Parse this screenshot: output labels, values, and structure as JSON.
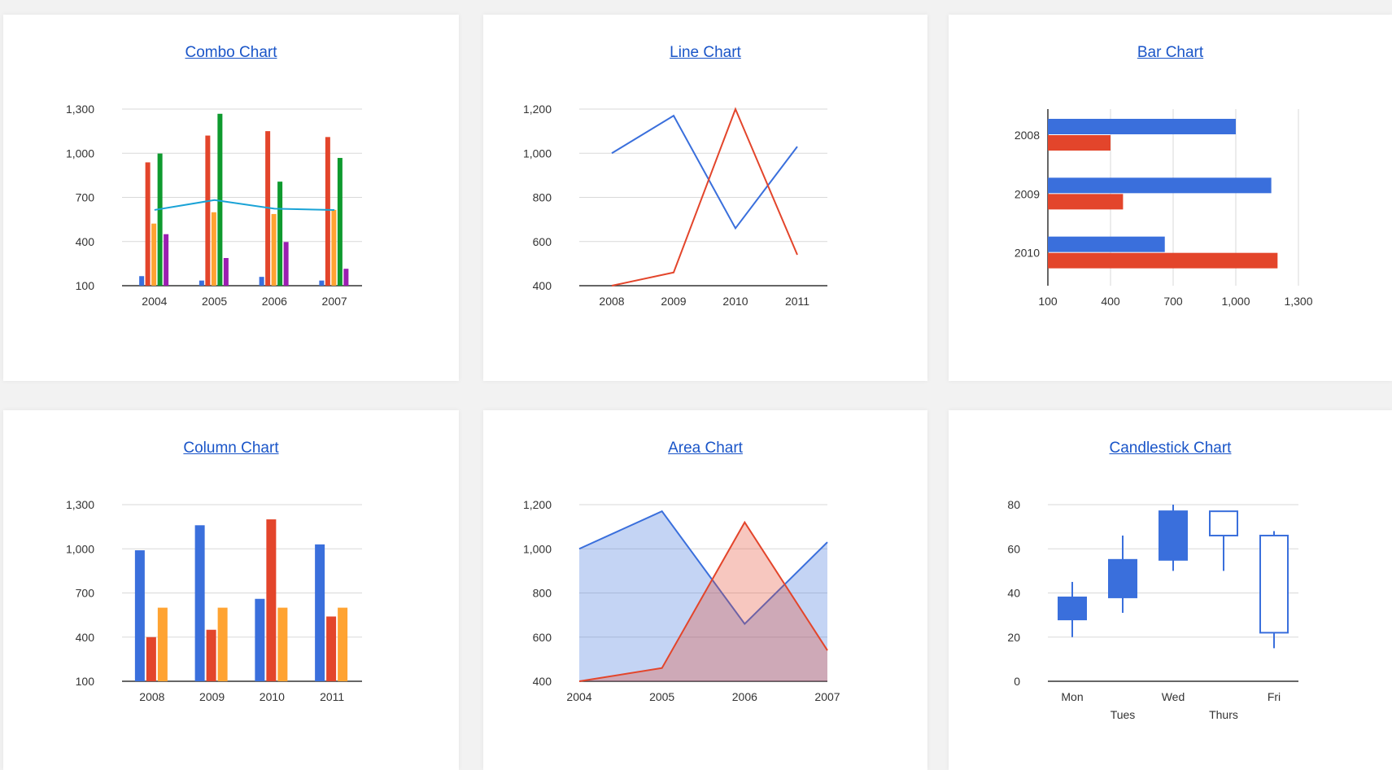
{
  "colors": {
    "blue": "#3a6fdc",
    "red": "#e3452b",
    "orange": "#ffa332",
    "green": "#0e9a2e",
    "purple": "#9a1fb0",
    "teal": "#1aa3d6",
    "link": "#1a55c8"
  },
  "chart_data": [
    {
      "id": "combo",
      "title": "Combo Chart",
      "type": "bar",
      "categories": [
        "2004",
        "2005",
        "2006",
        "2007"
      ],
      "ylim": [
        100,
        1300
      ],
      "yticks": [
        "100",
        "400",
        "700",
        "1,000",
        "1,300"
      ],
      "series": [
        {
          "values": [
            165,
            135,
            160,
            135
          ],
          "color": "blue"
        },
        {
          "values": [
            938,
            1120,
            1150,
            1110
          ],
          "color": "red"
        },
        {
          "values": [
            522,
            599,
            587,
            615
          ],
          "color": "orange"
        },
        {
          "values": [
            998,
            1268,
            807,
            968
          ],
          "color": "green"
        },
        {
          "values": [
            450,
            288,
            397,
            215
          ],
          "color": "purple"
        }
      ],
      "line": {
        "values": [
          614.6,
          682,
          623,
          614.6
        ],
        "color": "teal"
      }
    },
    {
      "id": "line",
      "title": "Line Chart",
      "type": "line",
      "categories": [
        "2008",
        "2009",
        "2010",
        "2011"
      ],
      "ylim": [
        400,
        1200
      ],
      "yticks": [
        "400",
        "600",
        "800",
        "1,000",
        "1,200"
      ],
      "series": [
        {
          "values": [
            1000,
            1170,
            660,
            1030
          ],
          "color": "blue"
        },
        {
          "values": [
            400,
            460,
            1200,
            540
          ],
          "color": "red"
        }
      ]
    },
    {
      "id": "bar",
      "title": "Bar Chart",
      "type": "bar",
      "orientation": "horizontal",
      "categories": [
        "2008",
        "2009",
        "2010"
      ],
      "xlim": [
        100,
        1300
      ],
      "xticks": [
        "100",
        "400",
        "700",
        "1,000",
        "1,300"
      ],
      "series": [
        {
          "values": [
            1000,
            1170,
            660
          ],
          "color": "blue"
        },
        {
          "values": [
            400,
            460,
            1200
          ],
          "color": "red"
        }
      ]
    },
    {
      "id": "column",
      "title": "Column Chart",
      "type": "bar",
      "categories": [
        "2008",
        "2009",
        "2010",
        "2011"
      ],
      "ylim": [
        100,
        1300
      ],
      "yticks": [
        "100",
        "400",
        "700",
        "1,000",
        "1,300"
      ],
      "series": [
        {
          "values": [
            990,
            1160,
            660,
            1030
          ],
          "color": "blue"
        },
        {
          "values": [
            400,
            450,
            1200,
            540
          ],
          "color": "red"
        },
        {
          "values": [
            600,
            600,
            600,
            600
          ],
          "color": "orange"
        }
      ]
    },
    {
      "id": "area",
      "title": "Area Chart",
      "type": "area",
      "categories": [
        "2004",
        "2005",
        "2006",
        "2007"
      ],
      "ylim": [
        400,
        1200
      ],
      "yticks": [
        "400",
        "600",
        "800",
        "1,000",
        "1,200"
      ],
      "series": [
        {
          "values": [
            1000,
            1170,
            660,
            1030
          ],
          "color": "blue"
        },
        {
          "values": [
            400,
            460,
            1120,
            540
          ],
          "color": "red"
        }
      ]
    },
    {
      "id": "candlestick",
      "title": "Candlestick Chart",
      "type": "candlestick",
      "categories": [
        "Mon",
        "Tues",
        "Wed",
        "Thurs",
        "Fri"
      ],
      "ylim": [
        0,
        80
      ],
      "yticks": [
        "0",
        "20",
        "40",
        "60",
        "80"
      ],
      "candles": [
        {
          "low": 20,
          "open": 28,
          "close": 38,
          "high": 45
        },
        {
          "low": 31,
          "open": 38,
          "close": 55,
          "high": 66
        },
        {
          "low": 50,
          "open": 55,
          "close": 77,
          "high": 80
        },
        {
          "low": 50,
          "open": 77,
          "close": 66,
          "high": 77
        },
        {
          "low": 15,
          "open": 66,
          "close": 22,
          "high": 68
        }
      ],
      "color": "blue"
    }
  ]
}
